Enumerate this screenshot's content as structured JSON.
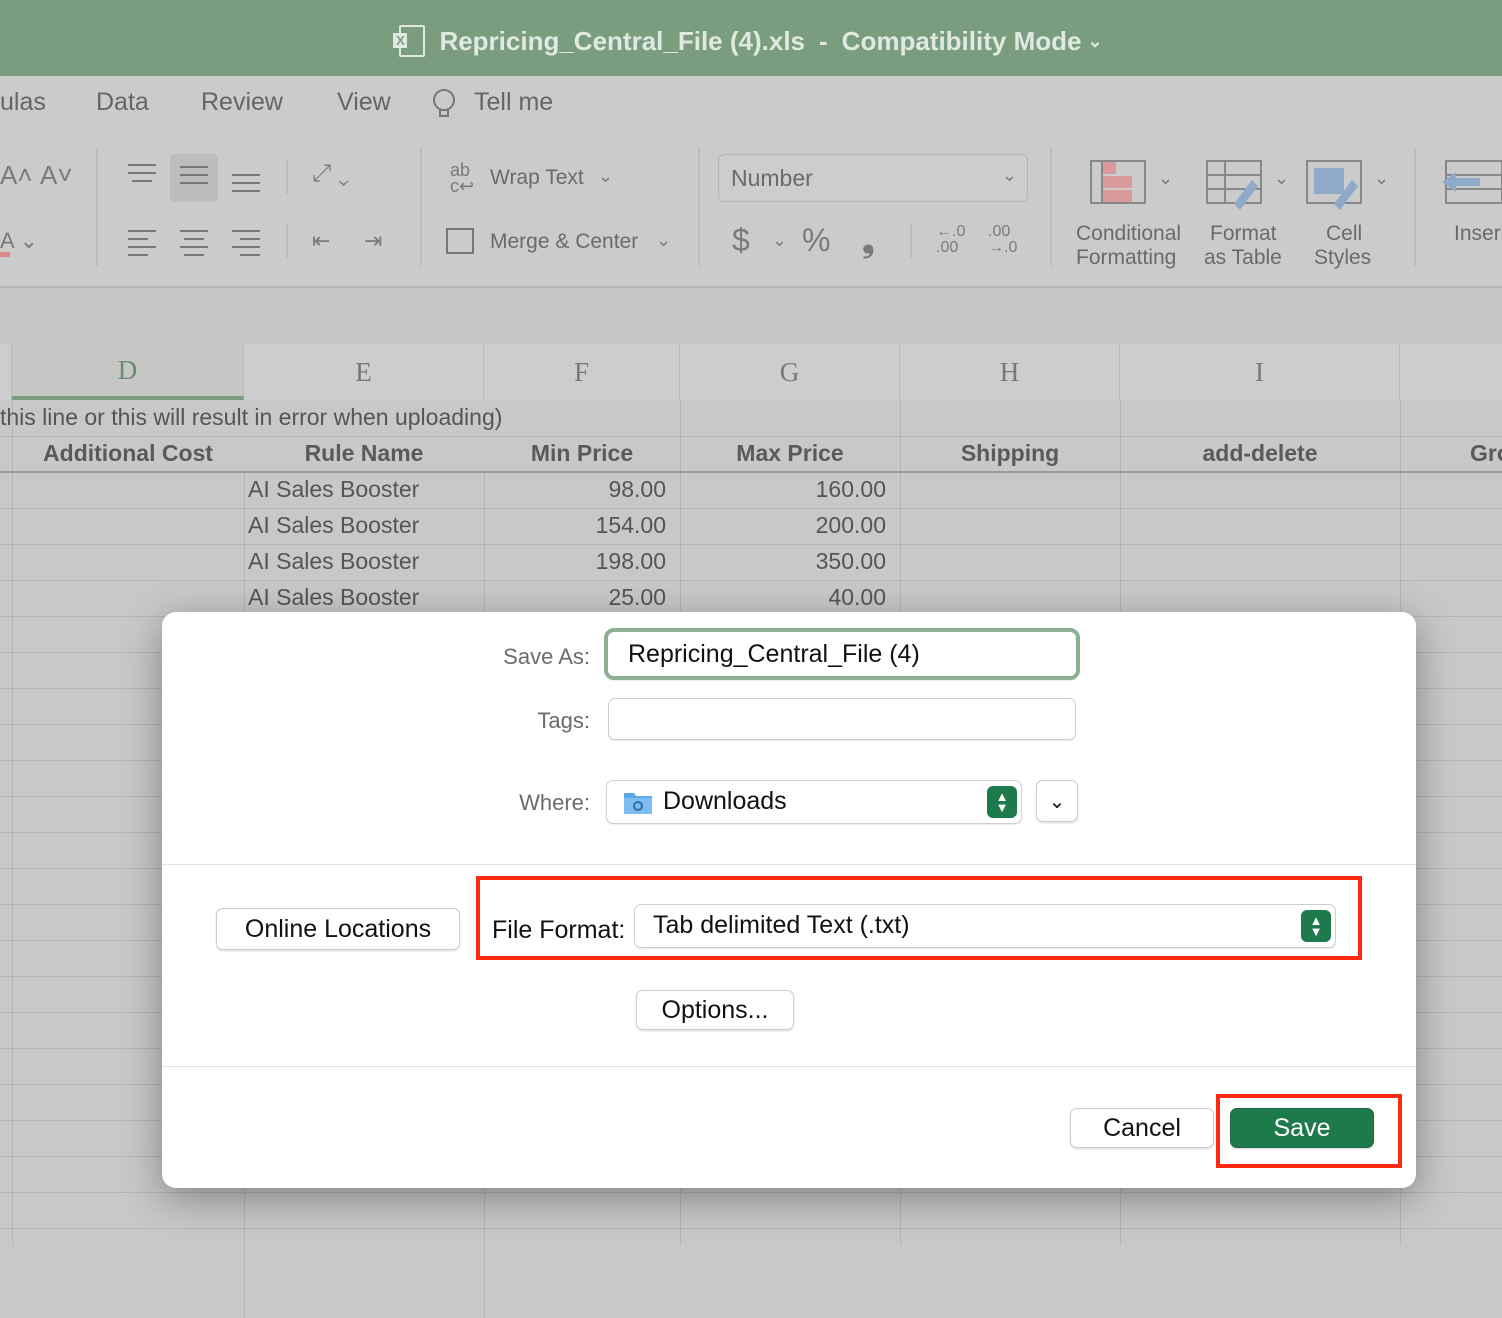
{
  "window": {
    "title_file": "Repricing_Central_File (4).xls",
    "title_sep": "-",
    "title_mode": "Compatibility Mode",
    "title_chevron": "⌄"
  },
  "ribbon": {
    "tabs": [
      "ulas",
      "Data",
      "Review",
      "View",
      "Tell me"
    ],
    "wrap_text": "Wrap Text",
    "merge_center": "Merge & Center",
    "number_format": "Number",
    "currency": "$",
    "percent": "%",
    "comma": "❟",
    "cond_format_1": "Conditional",
    "cond_format_2": "Formatting",
    "format_table_1": "Format",
    "format_table_2": "as Table",
    "cell_styles_1": "Cell",
    "cell_styles_2": "Styles",
    "insert": "Inser"
  },
  "sheet": {
    "columns": [
      "D",
      "E",
      "F",
      "G",
      "H",
      "I"
    ],
    "note_row": "this line or this will result in error when uploading)",
    "headers": [
      "Additional Cost",
      "Rule Name",
      "Min Price",
      "Max Price",
      "Shipping",
      "add-delete",
      "Gro"
    ],
    "rows": [
      {
        "rule": "AI Sales Booster",
        "min": "98.00",
        "max": "160.00"
      },
      {
        "rule": "AI Sales Booster",
        "min": "154.00",
        "max": "200.00"
      },
      {
        "rule": "AI Sales Booster",
        "min": "198.00",
        "max": "350.00"
      },
      {
        "rule": "AI Sales Booster",
        "min": "25.00",
        "max": "40.00"
      }
    ]
  },
  "dialog": {
    "save_as_label": "Save As:",
    "save_as_value": "Repricing_Central_File (4)",
    "tags_label": "Tags:",
    "tags_value": "",
    "where_label": "Where:",
    "where_value": "Downloads",
    "online_locations": "Online Locations",
    "file_format_label": "File Format:",
    "file_format_value": "Tab delimited Text (.txt)",
    "options": "Options...",
    "cancel": "Cancel",
    "save": "Save"
  },
  "colors": {
    "accent_green": "#7a9d7f",
    "save_green": "#1f7a4b",
    "highlight_red": "#ff2a12"
  }
}
